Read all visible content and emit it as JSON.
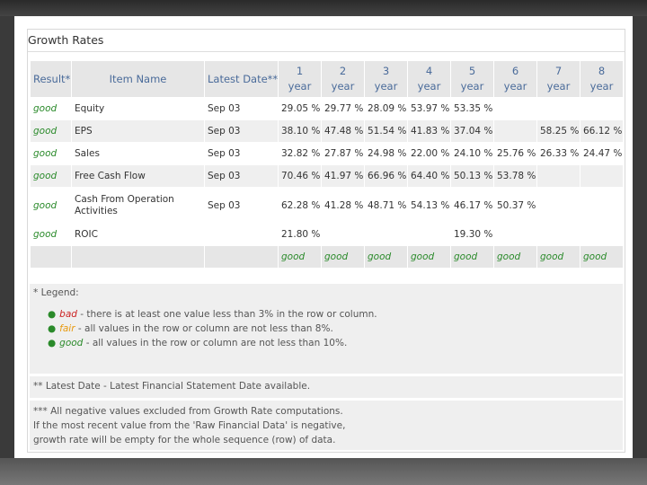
{
  "panel_title": "Growth Rates",
  "table": {
    "headers": {
      "result": "Result*",
      "item": "Item Name",
      "date": "Latest Date**",
      "years": [
        {
          "n": "1",
          "u": "year"
        },
        {
          "n": "2",
          "u": "year"
        },
        {
          "n": "3",
          "u": "year"
        },
        {
          "n": "4",
          "u": "year"
        },
        {
          "n": "5",
          "u": "year"
        },
        {
          "n": "6",
          "u": "year"
        },
        {
          "n": "7",
          "u": "year"
        },
        {
          "n": "8",
          "u": "year"
        }
      ]
    },
    "rows": [
      {
        "result": "good",
        "item": "Equity",
        "date": "Sep 03",
        "v": [
          "29.05 %",
          "29.77 %",
          "28.09 %",
          "53.97 %",
          "53.35 %",
          "",
          "",
          ""
        ]
      },
      {
        "result": "good",
        "item": "EPS",
        "date": "Sep 03",
        "v": [
          "38.10 %",
          "47.48 %",
          "51.54 %",
          "41.83 %",
          "37.04 %",
          "",
          "58.25 %",
          "66.12 %"
        ]
      },
      {
        "result": "good",
        "item": "Sales",
        "date": "Sep 03",
        "v": [
          "32.82 %",
          "27.87 %",
          "24.98 %",
          "22.00 %",
          "24.10 %",
          "25.76 %",
          "26.33 %",
          "24.47 %"
        ]
      },
      {
        "result": "good",
        "item": "Free Cash Flow",
        "date": "Sep 03",
        "v": [
          "70.46 %",
          "41.97 %",
          "66.96 %",
          "64.40 %",
          "50.13 %",
          "53.78 %",
          "",
          ""
        ]
      },
      {
        "result": "good",
        "item": "Cash From Operation Activities",
        "date": "Sep 03",
        "v": [
          "62.28 %",
          "41.28 %",
          "48.71 %",
          "54.13 %",
          "46.17 %",
          "50.37 %",
          "",
          ""
        ]
      },
      {
        "result": "good",
        "item": "ROIC",
        "date": "",
        "v": [
          "21.80 %",
          "",
          "",
          "",
          "19.30 %",
          "",
          "",
          ""
        ]
      }
    ],
    "summary": [
      "good",
      "good",
      "good",
      "good",
      "good",
      "good",
      "good",
      "good"
    ]
  },
  "legend": {
    "title": "* Legend:",
    "items": [
      {
        "term": "bad",
        "text": " - there is at least one value less than 3% in the row or column."
      },
      {
        "term": "fair",
        "text": " - all values in the row or column are not less than 8%."
      },
      {
        "term": "good",
        "text": " - all values in the row or column are not less than 10%."
      }
    ]
  },
  "latest_note": "** Latest Date - Latest Financial Statement Date available.",
  "exclude_note": [
    "*** All negative values excluded from Growth Rate computations.",
    "If the most recent value from the 'Raw Financial Data' is negative,",
    "growth rate will be empty for the whole sequence (row) of data."
  ],
  "colors": {
    "good": "#2a8a2a",
    "fair": "#e89a10",
    "bad": "#cc2222",
    "header_text": "#4a6b9a"
  }
}
